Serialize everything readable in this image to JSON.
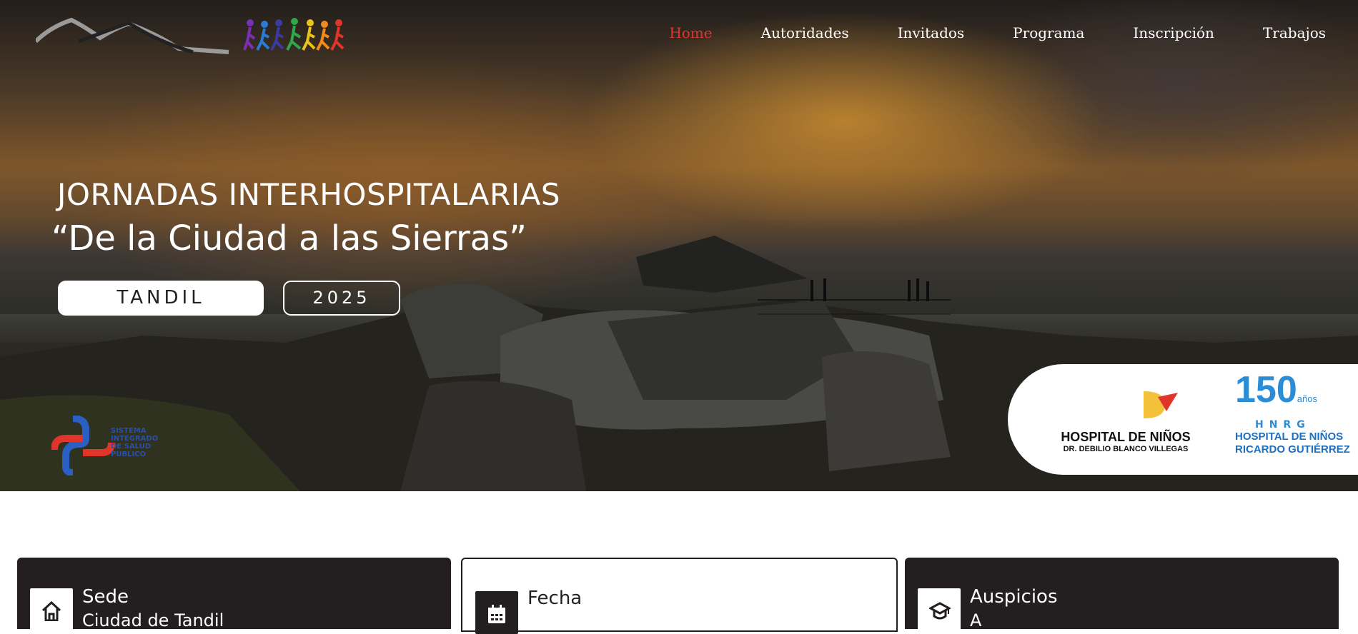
{
  "nav": {
    "items": [
      {
        "label": "Home",
        "active": true
      },
      {
        "label": "Autoridades",
        "active": false
      },
      {
        "label": "Invitados",
        "active": false
      },
      {
        "label": "Programa",
        "active": false
      },
      {
        "label": "Inscripción",
        "active": false
      },
      {
        "label": "Trabajos",
        "active": false
      }
    ],
    "active_color": "#e5332a"
  },
  "hero": {
    "title": "JORNADAS INTERHOSPITALARIAS",
    "subtitle": "“De la Ciudad a las Sierras”",
    "city_button": "TANDIL",
    "year_button": "2025"
  },
  "sistema_logo": {
    "lines": [
      "SISTEMA",
      "INTEGRADO",
      "DE SALUD",
      "PUBLICO"
    ]
  },
  "partners": {
    "hospital_1_name": "HOSPITAL DE NIÑOS",
    "hospital_1_sub": "DR. DEBILIO BLANCO VILLEGAS",
    "anniversary_number": "150",
    "anniversary_unit": "años",
    "hospital_2_initials": "HNRG",
    "hospital_2_name_line1": "HOSPITAL DE NIÑOS",
    "hospital_2_name_line2": "RICARDO GUTIÉRREZ"
  },
  "cards": [
    {
      "title": "Sede",
      "value": "Ciudad de Tandil",
      "icon": "home-icon",
      "style": "dark"
    },
    {
      "title": "Fecha",
      "value": "",
      "icon": "calendar-icon",
      "style": "light"
    },
    {
      "title": "Auspicios",
      "value": "A",
      "icon": "graduation-cap-icon",
      "style": "dark"
    }
  ]
}
